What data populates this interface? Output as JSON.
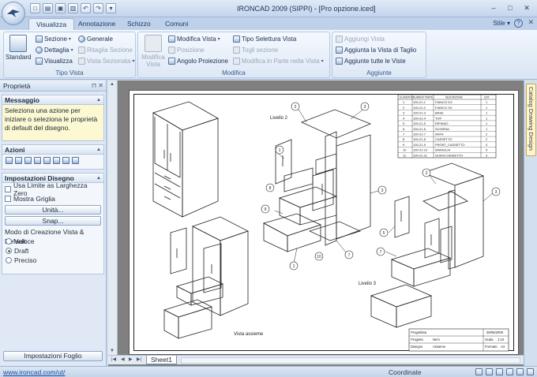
{
  "window": {
    "title": "IRONCAD 2009 (SIPPI) - [Pro opzione.iced]",
    "controls": [
      "–",
      "□",
      "✕"
    ]
  },
  "quick_access": {
    "icons": [
      "new-icon",
      "open-icon",
      "save-icon",
      "print-icon",
      "undo-icon",
      "redo-icon"
    ]
  },
  "tabs": [
    "Visualizza",
    "Annotazione",
    "Schizzo",
    "Comuni"
  ],
  "tabs_right": {
    "style_label": "Stile",
    "help": "?",
    "close": "✕"
  },
  "ribbon": {
    "tipo_vista": {
      "label": "Tipo Vista",
      "standard": "Standard",
      "sezione": "Sezione",
      "dettaglia": "Dettaglia",
      "visualizza": "Visualizza",
      "generale": "Generale",
      "ritaglia_sezione": "Ritaglia Sezione",
      "vista_sezionata": "Vista Sezionata"
    },
    "modifica": {
      "label": "Modifica",
      "modifica_vista_big": "Modifica Vista",
      "modifica_vista": "Modifica Vista",
      "posizione": "Posizione",
      "angolo_proiezione": "Angolo Proiezione",
      "tipo_selettura": "Tipo Selettura Vista",
      "togli_sezione": "Togli sezione",
      "modifica_in_parte": "Modifica in Parte nella Vista"
    },
    "aggiunte": {
      "label": "Aggiunte",
      "aggiungi_vista": "Aggiungi Vista",
      "aggiunta_taglio": "Aggiunta la Vista di Taglio",
      "aggiunte_tutte": "Aggiunte tutte le Viste"
    }
  },
  "panel": {
    "title": "Proprietà",
    "messaggio_head": "Messaggio",
    "messaggio": "Seleziona una azione per iniziare o seleziona le proprietà di default del disegno.",
    "azioni_head": "Azioni",
    "impostazioni_head": "Impostazioni Disegno",
    "usa_limite": "Usa Limite as Larghezza Zero",
    "mostra_griglia": "Mostra Griglia",
    "unita_btn": "Unità...",
    "snap_btn": "Snap...",
    "modo_label": "Modo di Creazione Vista & Default",
    "options": [
      "Veloce",
      "Draft",
      "Preciso"
    ],
    "selected_option": "Draft",
    "foot_button": "Impostazioni Foglio"
  },
  "drawing": {
    "sheet_tab": "Sheet1",
    "label_livello2": "Livello 2",
    "label_livello3": "Livello 3",
    "label_vista_assieme": "Vista assieme",
    "bom_headers": [
      "ELEMENTO",
      "NUMERO PARTE",
      "DESCRIZIONE",
      "QTA"
    ],
    "bom_rows": [
      [
        "1",
        "100-21-1",
        "FIANCO DX",
        "1"
      ],
      [
        "2",
        "100-21-2",
        "FIANCO SX",
        "1"
      ],
      [
        "3",
        "100-21-3",
        "BASE",
        "1"
      ],
      [
        "4",
        "100-21-4",
        "TOP",
        "1"
      ],
      [
        "5",
        "100-21-5",
        "RIPIANO",
        "1"
      ],
      [
        "6",
        "100-21-6",
        "SCHIENA",
        "1"
      ],
      [
        "7",
        "100-21-7",
        "ANTA",
        "2"
      ],
      [
        "8",
        "100-21-8",
        "CASSETTO",
        "2"
      ],
      [
        "9",
        "100-21-9",
        "FRONT_CASSETTO",
        "3"
      ],
      [
        "10",
        "100-21-10",
        "MANIGLIA",
        "5"
      ],
      [
        "11",
        "100-21-11",
        "GUIDA CASSETTO",
        "3"
      ]
    ],
    "title_block": {
      "progettista_label": "Progettista",
      "date": "08/06/2009",
      "progetto_label": "Progetto",
      "progetto": "Nem",
      "scala_label": "Scala",
      "scala": "1:10",
      "disegno_label": "Disegno",
      "disegno": "Assieme",
      "formato_label": "Formato",
      "formato": "A3"
    },
    "balloons": [
      "1",
      "2",
      "3",
      "4",
      "5",
      "6",
      "7",
      "8",
      "9",
      "10"
    ]
  },
  "catalog": {
    "tab_label": "Catalog Drawing Design"
  },
  "status": {
    "url": "www.ironcad.com/ut/",
    "coordinate": "Coordinate"
  }
}
